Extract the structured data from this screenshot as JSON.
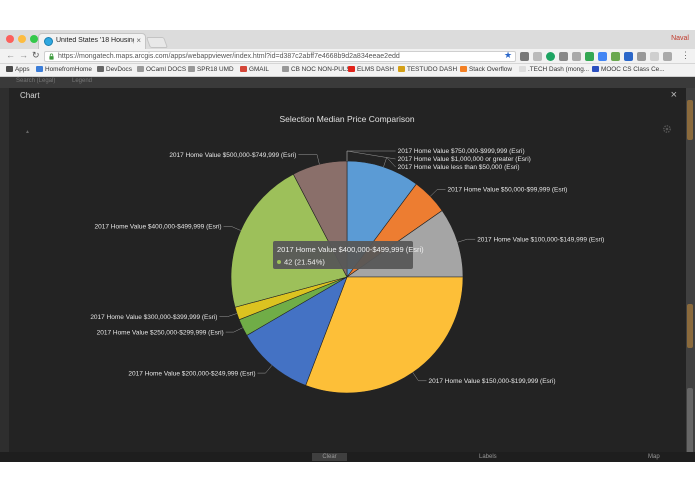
{
  "browser": {
    "tab_title": "United States '18 Housing Ma",
    "url": "https://mongatech.maps.arcgis.com/apps/webappviewer/index.html?id=d387c2abff7e4668b9d2a834eeae2edd",
    "profile_name": "Naval",
    "bookmarks": [
      {
        "label": "Apps",
        "color": "#4a4a4a"
      },
      {
        "label": "HomefromHome",
        "color": "#3b7dd8"
      },
      {
        "label": "DevDocs",
        "color": "#666666"
      },
      {
        "label": "OCaml DOCS",
        "color": "#999999"
      },
      {
        "label": "SPR18 UMD",
        "color": "#999999"
      },
      {
        "label": "GMAIL",
        "color": "#d44638"
      },
      {
        "label": "CB NOC NON-PULSE",
        "color": "#999999"
      },
      {
        "label": "ELMS DASH",
        "color": "#e2231a"
      },
      {
        "label": "TESTUDO DASH",
        "color": "#d4a017"
      },
      {
        "label": "Stack Overflow",
        "color": "#f48024"
      },
      {
        "label": ".TECH Dash (mong...",
        "color": "#dddddd"
      },
      {
        "label": "MOOC CS Class Ce...",
        "color": "#2b4fbf"
      }
    ]
  },
  "app": {
    "top_strip": [
      "Search (Legal)",
      "Legend"
    ],
    "panel_title": "Chart",
    "clear_label": "Clear",
    "labels_label": "Labels",
    "map_label": "Map"
  },
  "tooltip": {
    "title": "2017 Home Value $400,000-$499,999 (Esri)",
    "value_text": "42 (21.54%)",
    "dot_color": "#9dc05a"
  },
  "chart_data": {
    "type": "pie",
    "title": "Selection Median Price Comparison",
    "start_angle_deg": 0,
    "direction": "clockwise",
    "highlighted_index": 11,
    "slices": [
      {
        "label": "2017 Home Value less than $50,000 (Esri)",
        "percent": 10.2,
        "color": "#5b9bd5"
      },
      {
        "label": "2017 Home Value $50,000-$99,999 (Esri)",
        "percent": 5.1,
        "color": "#ed7d31"
      },
      {
        "label": "2017 Home Value $100,000-$149,999 (Esri)",
        "percent": 9.7,
        "color": "#a5a5a5"
      },
      {
        "label": "2017 Home Value $150,000-$199,999 (Esri)",
        "percent": 30.8,
        "color": "#fdbf38"
      },
      {
        "label": "2017 Home Value $200,000-$249,999 (Esri)",
        "percent": 10.8,
        "color": "#4472c4"
      },
      {
        "label": "2017 Home Value $250,000-$299,999 (Esri)",
        "percent": 2.4,
        "color": "#70ad47"
      },
      {
        "label": "2017 Home Value $300,000-$399,999 (Esri)",
        "percent": 1.8,
        "color": "#dcc320"
      },
      {
        "label": "2017 Home Value $400,000-$499,999 (Esri)",
        "percent": 21.54,
        "color": "#9dc05a"
      },
      {
        "label": "2017 Home Value $500,000-$749,999 (Esri)",
        "percent": 7.66,
        "color": "#8a6f6a"
      },
      {
        "label": "2017 Home Value $750,000-$999,999 (Esri)",
        "percent": 0,
        "color": "#5b9bd5"
      },
      {
        "label": "2017 Home Value $1,000,000 or greater (Esri)",
        "percent": 0,
        "color": "#ed7d31"
      }
    ]
  }
}
